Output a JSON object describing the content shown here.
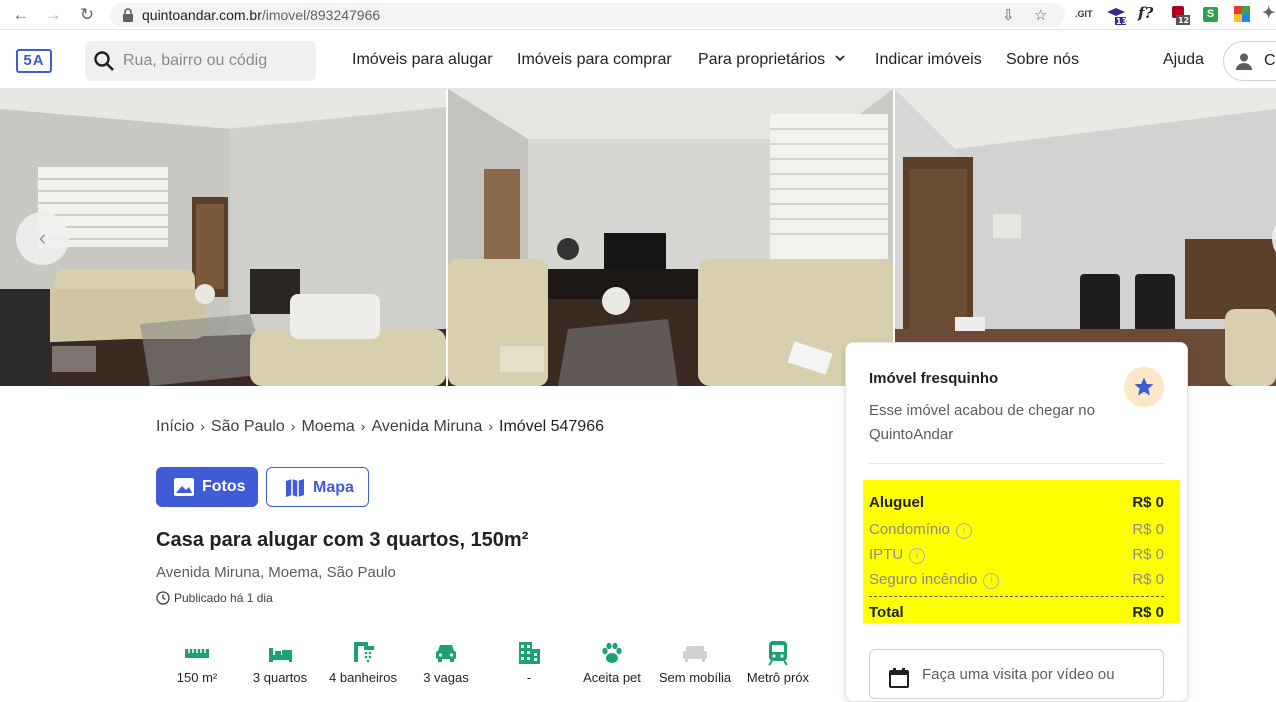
{
  "browser": {
    "url_host": "quintoandar.com.br",
    "url_path": "/imovel/893247966",
    "ext_git": ".GIT",
    "ext_badge_1": "13",
    "ext_fx": "f?",
    "ext_badge_2": "12",
    "ext_s": "S"
  },
  "header": {
    "logo_text": "5A",
    "search_placeholder": "Rua, bairro ou códig",
    "menu": [
      "Imóveis para alugar",
      "Imóveis para comprar",
      "Para proprietários",
      "Indicar imóveis",
      "Sobre nós",
      "Ajuda"
    ],
    "user_label": "Co"
  },
  "breadcrumb": [
    "Início",
    "São Paulo",
    "Moema",
    "Avenida Miruna",
    "Imóvel 547966"
  ],
  "actions": {
    "fotos": "Fotos",
    "mapa": "Mapa"
  },
  "listing": {
    "title": "Casa para alugar com 3 quartos, 150m²",
    "address": "Avenida Miruna, Moema, São Paulo",
    "published": "Publicado há 1 dia"
  },
  "features": [
    {
      "label": "150 m²",
      "icon": "ruler-icon"
    },
    {
      "label": "3 quartos",
      "icon": "bed-icon"
    },
    {
      "label": "4 banheiros",
      "icon": "shower-icon"
    },
    {
      "label": "3 vagas",
      "icon": "car-icon"
    },
    {
      "label": "-",
      "icon": "building-icon"
    },
    {
      "label": "Aceita pet",
      "icon": "paw-icon"
    },
    {
      "label": "Sem mobília",
      "icon": "sofa-icon"
    },
    {
      "label": "Metrô próx",
      "icon": "metro-icon"
    }
  ],
  "card": {
    "title": "Imóvel fresquinho",
    "description": "Esse imóvel acabou de chegar no QuintoAndar",
    "rows": [
      {
        "label": "Aluguel",
        "value": "R$ 0"
      },
      {
        "label": "Condomínio",
        "value": "R$ 0"
      },
      {
        "label": "IPTU",
        "value": "R$ 0"
      },
      {
        "label": "Seguro incêndio",
        "value": "R$ 0"
      }
    ],
    "total": {
      "label": "Total",
      "value": "R$ 0"
    },
    "visit_label": "Faça uma visita por vídeo ou"
  },
  "colors": {
    "brand": "#3f5bd6",
    "highlight": "#ffff00",
    "star_bg": "#fde7c7"
  }
}
